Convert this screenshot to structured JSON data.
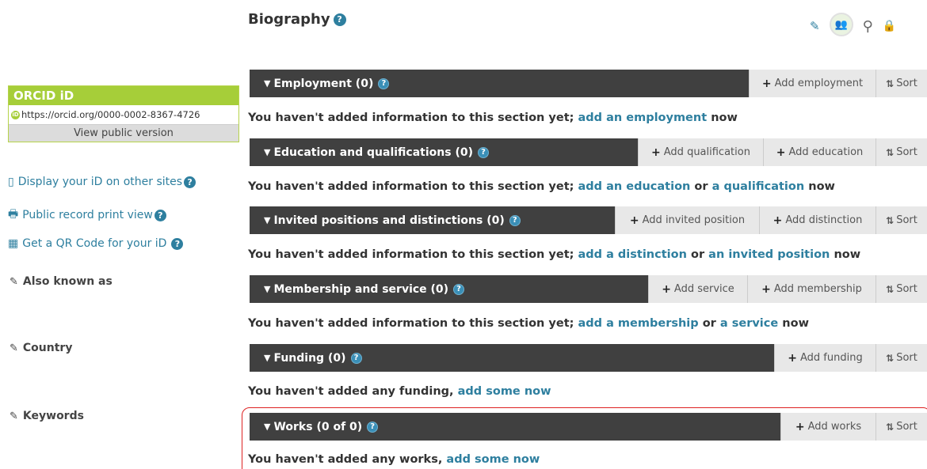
{
  "sidebar": {
    "orcid_title": "ORCID iD",
    "orcid_url": "https://orcid.org/0000-0002-8367-4726",
    "view_public": "View public version",
    "links": [
      {
        "label": "Display your iD on other sites",
        "icon": "mobile-icon"
      },
      {
        "label": "Public record print view",
        "icon": "print-icon"
      },
      {
        "label": "Get a QR Code for your iD",
        "icon": "qr-code-icon"
      }
    ],
    "edit_items": [
      "Also known as",
      "Country",
      "Keywords"
    ]
  },
  "biography": {
    "title": "Biography"
  },
  "sections": {
    "employment": {
      "title": "Employment (0)",
      "btn1": "Add employment",
      "sort": "Sort",
      "msg_prefix": "You haven't added information to this section yet;",
      "link1": "add an employment",
      "msg_suffix": "now"
    },
    "education": {
      "title": "Education and qualifications (0)",
      "btn1": "Add qualification",
      "btn2": "Add education",
      "sort": "Sort",
      "msg_prefix": "You haven't added information to this section yet;",
      "link1": "add an education",
      "or": "or",
      "link2": "a qualification",
      "msg_suffix": "now"
    },
    "invited": {
      "title": "Invited positions and distinctions (0)",
      "btn1": "Add invited position",
      "btn2": "Add distinction",
      "sort": "Sort",
      "msg_prefix": "You haven't added information to this section yet;",
      "link1": "add a distinction",
      "or": "or",
      "link2": "an invited position",
      "msg_suffix": "now"
    },
    "membership": {
      "title": "Membership and service (0)",
      "btn1": "Add service",
      "btn2": "Add membership",
      "sort": "Sort",
      "msg_prefix": "You haven't added information to this section yet;",
      "link1": "add a membership",
      "or": "or",
      "link2": "a service",
      "msg_suffix": "now"
    },
    "funding": {
      "title": "Funding (0)",
      "btn1": "Add funding",
      "sort": "Sort",
      "msg_prefix": "You haven't added any funding,",
      "link1": "add some now"
    },
    "works": {
      "title": "Works (0 of 0)",
      "btn1": "Add works",
      "sort": "Sort",
      "msg_prefix": "You haven't added any works,",
      "link1": "add some now"
    }
  },
  "colors": {
    "orcid_green": "#a6ce39",
    "link_blue": "#2e7f9f",
    "bar_dark": "#404040",
    "highlight_red": "#dd2222"
  }
}
